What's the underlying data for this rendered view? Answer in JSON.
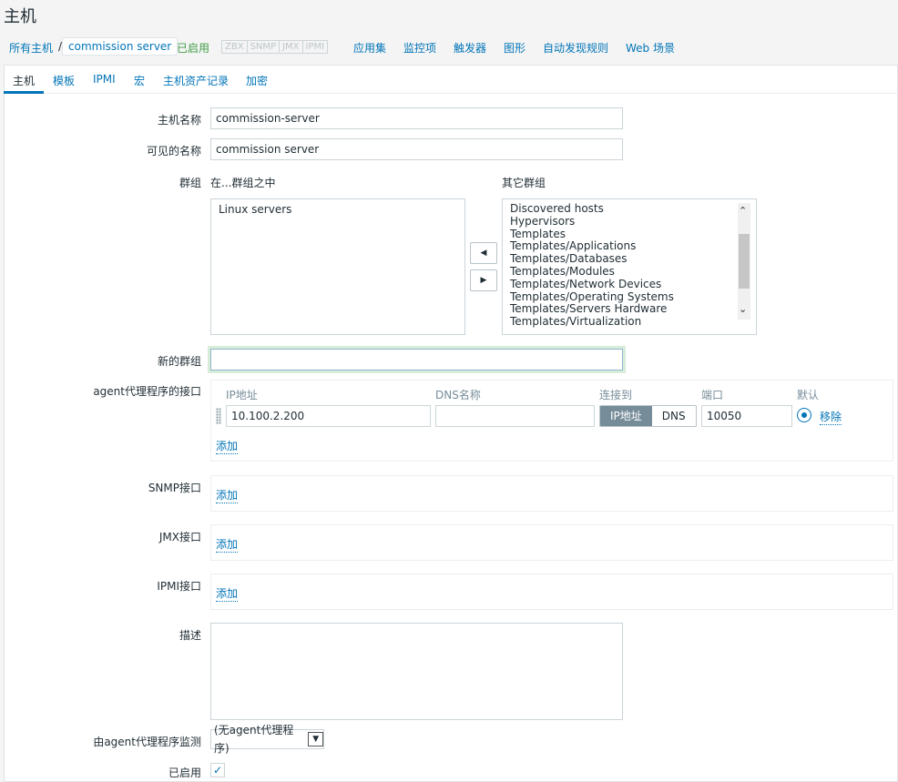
{
  "page": {
    "title": "主机"
  },
  "breadcrumb": {
    "all_hosts": "所有主机",
    "separator": "/",
    "current": "commission server",
    "status": "已启用",
    "availability": [
      "ZBX",
      "SNMP",
      "JMX",
      "IPMI"
    ],
    "links": [
      "应用集",
      "监控项",
      "触发器",
      "图形",
      "自动发现规则",
      "Web 场景"
    ]
  },
  "tabs": [
    "主机",
    "模板",
    "IPMI",
    "宏",
    "主机资产记录",
    "加密"
  ],
  "form": {
    "host_name_label": "主机名称",
    "host_name_value": "commission-server",
    "visible_name_label": "可见的名称",
    "visible_name_value": "commission server",
    "groups_label": "群组",
    "in_groups_label": "在...群组之中",
    "other_groups_label": "其它群组",
    "in_groups": [
      "Linux servers"
    ],
    "other_groups": [
      "Discovered hosts",
      "Hypervisors",
      "Templates",
      "Templates/Applications",
      "Templates/Databases",
      "Templates/Modules",
      "Templates/Network Devices",
      "Templates/Operating Systems",
      "Templates/Servers Hardware",
      "Templates/Virtualization"
    ],
    "new_group_label": "新的群组",
    "new_group_value": "",
    "agent_iface_label": "agent代理程序的接口",
    "iface_cols": {
      "ip": "IP地址",
      "dns": "DNS名称",
      "connect": "连接到",
      "port": "端口",
      "default": "默认"
    },
    "iface_ip": "10.100.2.200",
    "iface_dns": "",
    "connect_ip": "IP地址",
    "connect_dns": "DNS",
    "iface_port": "10050",
    "remove_label": "移除",
    "add_label": "添加",
    "snmp_label": "SNMP接口",
    "jmx_label": "JMX接口",
    "ipmi_label": "IPMI接口",
    "description_label": "描述",
    "proxy_label": "由agent代理程序监测",
    "proxy_value": "(无agent代理程序)",
    "enabled_label": "已启用"
  },
  "colors": {
    "link": "#0275b8",
    "enabled": "#429e47",
    "segment_active": "#768d99"
  }
}
